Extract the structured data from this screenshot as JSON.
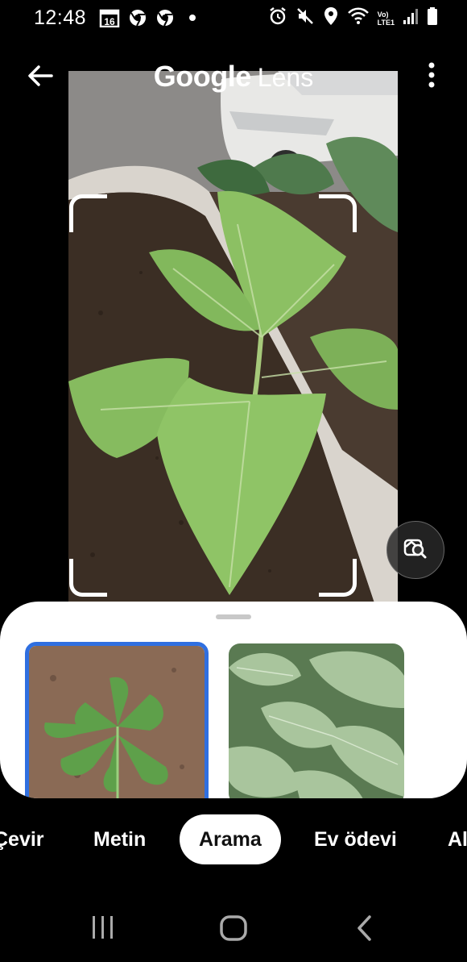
{
  "status_bar": {
    "time": "12:48",
    "calendar_badge": "16",
    "network_label_top": "Vo)",
    "network_label_bottom": "LTE1"
  },
  "header": {
    "brand_google": "Google",
    "brand_lens": "Lens"
  },
  "tabs": {
    "items": [
      "Çevir",
      "Metin",
      "Arama",
      "Ev ödevi",
      "Al"
    ],
    "active": "Arama"
  },
  "colors": {
    "selection_border": "#2f6fe0",
    "sheet_background": "#ffffff",
    "background": "#000000"
  }
}
